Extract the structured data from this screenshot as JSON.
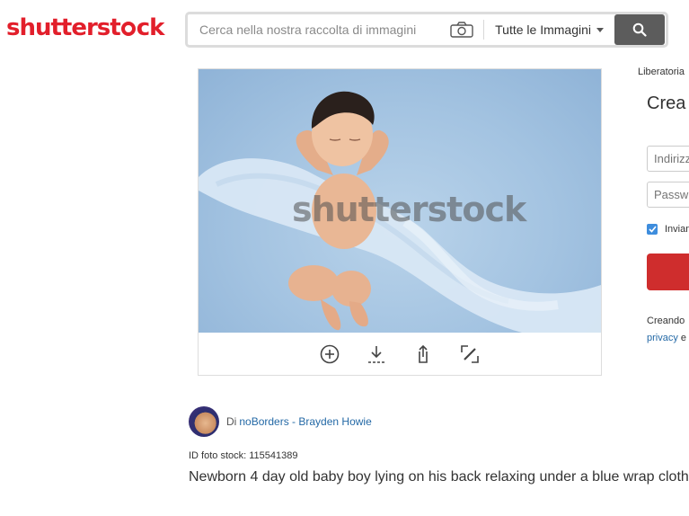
{
  "header": {
    "logo": {
      "before": "shutterst",
      "after": "ck",
      "color": "#e21f2b"
    },
    "search": {
      "placeholder": "Cerca nella nostra raccolta di immagini",
      "value": "",
      "camera_icon": "camera-icon",
      "type_selected": "Tutte le Immagini",
      "search_icon": "magnifier-icon"
    }
  },
  "image": {
    "watermark": "shutterstock",
    "actions": [
      {
        "icon": "add-circle-icon"
      },
      {
        "icon": "download-icon"
      },
      {
        "icon": "share-icon"
      },
      {
        "icon": "edit-icon"
      }
    ]
  },
  "panel": {
    "library_link": "Liberatoria",
    "heading": "Crea i",
    "email_placeholder": "Indirizz",
    "password_placeholder": "Passw",
    "checkbox_label": "Inviam",
    "checkbox_checked": true,
    "creating_text": "Creando",
    "privacy_link": "privacy",
    "privacy_tail": "e",
    "accent": "#cf2d2d"
  },
  "details": {
    "by": "Di",
    "author": "noBorders - Brayden Howie",
    "stock_id": "ID foto stock: 115541389",
    "description": "Newborn 4 day old baby boy lying on his back relaxing under a blue wrap cloth"
  }
}
